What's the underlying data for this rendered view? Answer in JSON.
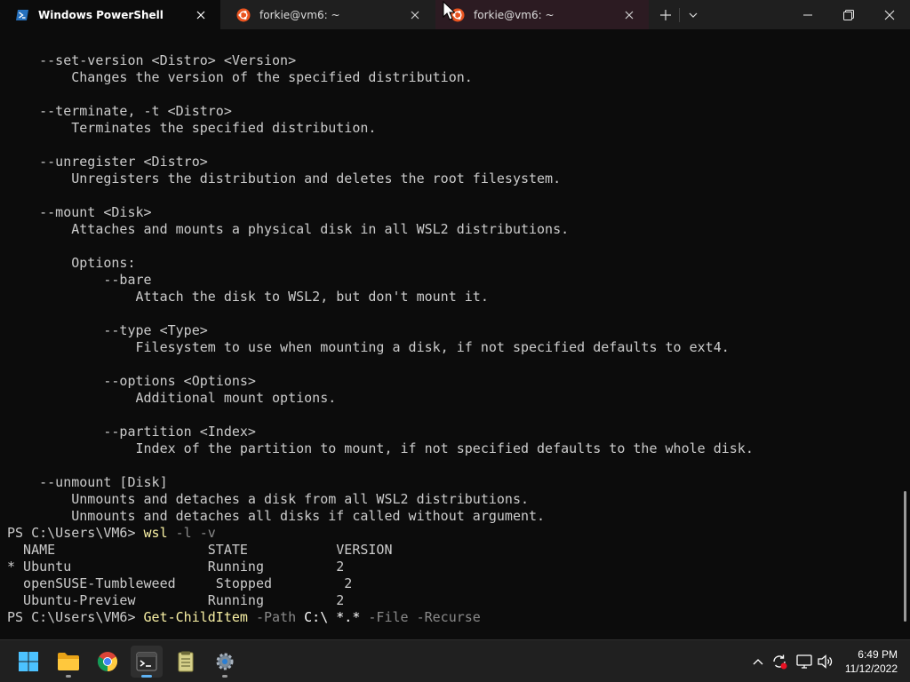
{
  "tabs": [
    {
      "title": "Windows PowerShell",
      "icon": "powershell-icon",
      "active": true
    },
    {
      "title": "forkie@vm6: ~",
      "icon": "ubuntu-icon",
      "active": false
    },
    {
      "title": "forkie@vm6: ~",
      "icon": "ubuntu-icon",
      "active": false
    }
  ],
  "tab_close_glyph": "✕",
  "new_tab_glyph": "+",
  "dropdown_glyph": "⌄",
  "window_controls": {
    "minimize": "—",
    "maximize": "❐",
    "close": "✕"
  },
  "terminal": {
    "lines": [
      [
        {
          "t": "    --set-version <Distro> <Version>"
        }
      ],
      [
        {
          "t": "        Changes the version of the specified distribution."
        }
      ],
      [
        {
          "t": ""
        }
      ],
      [
        {
          "t": "    --terminate, -t <Distro>"
        }
      ],
      [
        {
          "t": "        Terminates the specified distribution."
        }
      ],
      [
        {
          "t": ""
        }
      ],
      [
        {
          "t": "    --unregister <Distro>"
        }
      ],
      [
        {
          "t": "        Unregisters the distribution and deletes the root filesystem."
        }
      ],
      [
        {
          "t": ""
        }
      ],
      [
        {
          "t": "    --mount <Disk>"
        }
      ],
      [
        {
          "t": "        Attaches and mounts a physical disk in all WSL2 distributions."
        }
      ],
      [
        {
          "t": ""
        }
      ],
      [
        {
          "t": "        Options:"
        }
      ],
      [
        {
          "t": "            --bare"
        }
      ],
      [
        {
          "t": "                Attach the disk to WSL2, but don't mount it."
        }
      ],
      [
        {
          "t": ""
        }
      ],
      [
        {
          "t": "            --type <Type>"
        }
      ],
      [
        {
          "t": "                Filesystem to use when mounting a disk, if not specified defaults to ext4."
        }
      ],
      [
        {
          "t": ""
        }
      ],
      [
        {
          "t": "            --options <Options>"
        }
      ],
      [
        {
          "t": "                Additional mount options."
        }
      ],
      [
        {
          "t": ""
        }
      ],
      [
        {
          "t": "            --partition <Index>"
        }
      ],
      [
        {
          "t": "                Index of the partition to mount, if not specified defaults to the whole disk."
        }
      ],
      [
        {
          "t": ""
        }
      ],
      [
        {
          "t": "    --unmount [Disk]"
        }
      ],
      [
        {
          "t": "        Unmounts and detaches a disk from all WSL2 distributions."
        }
      ],
      [
        {
          "t": "        Unmounts and detaches all disks if called without argument."
        }
      ],
      [
        {
          "t": "PS C:\\Users\\VM6> "
        },
        {
          "t": "wsl",
          "c": "cmd"
        },
        {
          "t": " -l -v",
          "c": "arg"
        }
      ],
      [
        {
          "t": "  NAME                   STATE           VERSION"
        }
      ],
      [
        {
          "t": "* Ubuntu                 Running         2"
        }
      ],
      [
        {
          "t": "  openSUSE-Tumbleweed     Stopped         2"
        }
      ],
      [
        {
          "t": "  Ubuntu-Preview         Running         2"
        }
      ],
      [
        {
          "t": "PS C:\\Users\\VM6> "
        },
        {
          "t": "Get-ChildItem",
          "c": "cmd"
        },
        {
          "t": " -Path",
          "c": "arg"
        },
        {
          "t": " C:\\ *.*",
          "c": "path"
        },
        {
          "t": " -File -Recurse",
          "c": "arg"
        }
      ]
    ]
  },
  "taskbar": {
    "apps": [
      {
        "name": "start-button",
        "icon": "windows-logo-icon"
      },
      {
        "name": "file-explorer",
        "icon": "folder-icon"
      },
      {
        "name": "chrome",
        "icon": "chrome-icon"
      },
      {
        "name": "terminal",
        "icon": "terminal-icon"
      },
      {
        "name": "notepad",
        "icon": "notepad-icon"
      },
      {
        "name": "settings",
        "icon": "gear-icon"
      }
    ],
    "tray": [
      "chevron-up-icon",
      "sync-error-icon",
      "network-icon",
      "volume-icon"
    ],
    "time": "6:49 PM",
    "date": "11/12/2022"
  },
  "colors": {
    "background": "#0c0c0c",
    "text": "#cccccc",
    "command": "#f9f1a5",
    "argument": "#8a8a8a",
    "accent": "#5fb2f2"
  }
}
